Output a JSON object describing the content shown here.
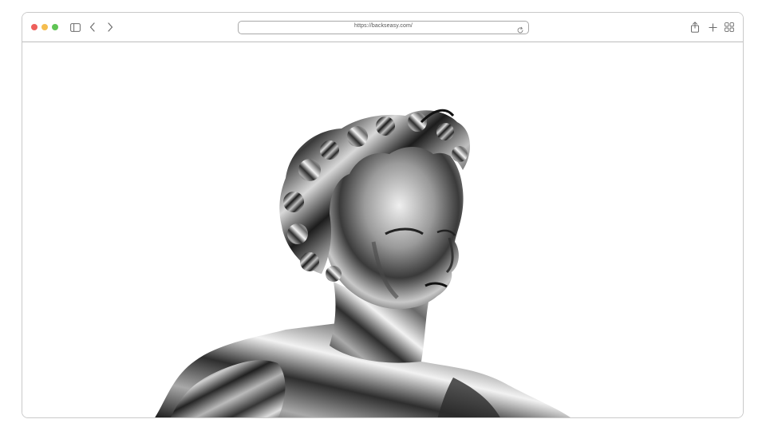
{
  "browser": {
    "traffic_lights": {
      "close_color": "#ee5f5b",
      "minimize_color": "#f5bd4f",
      "maximize_color": "#5fc454"
    },
    "toolbar_icons": [
      "sidebar-icon",
      "back-chevron-icon",
      "forward-chevron-icon",
      "share-icon",
      "new-tab-plus-icon",
      "tab-overview-icon"
    ],
    "address_bar": {
      "url": "https://backseasy.com/",
      "reload_icon": "reload-icon"
    }
  },
  "page": {
    "hero_image": "chrome-statue-bust"
  }
}
